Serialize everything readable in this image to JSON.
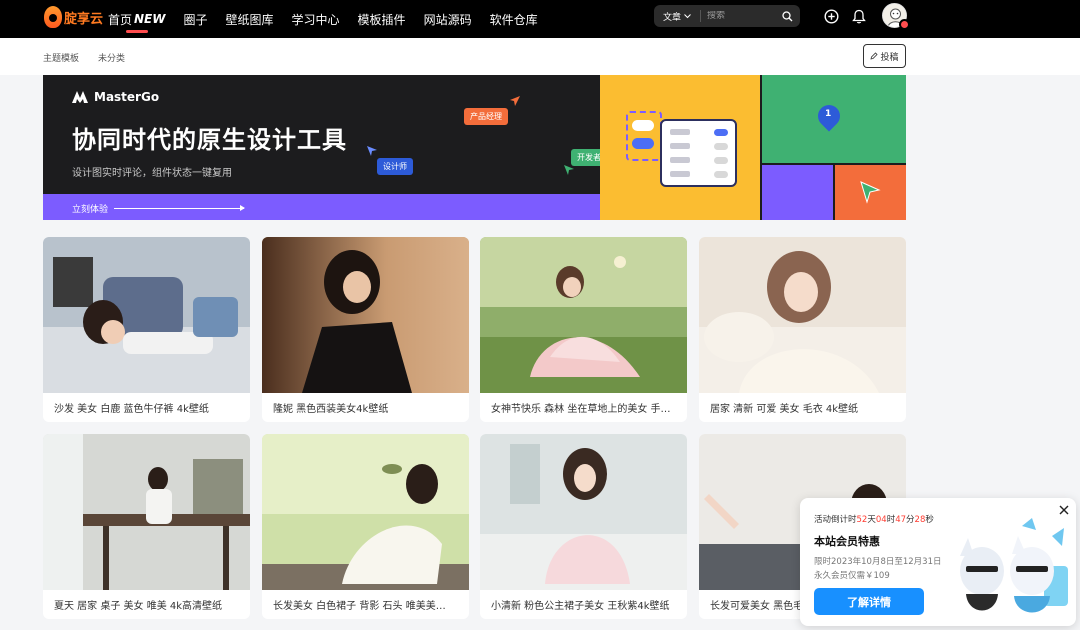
{
  "header": {
    "logo_text": "腚享云",
    "nav": [
      {
        "label": "首页",
        "suffix": "NEW"
      },
      {
        "label": "圈子"
      },
      {
        "label": "壁纸图库"
      },
      {
        "label": "学习中心"
      },
      {
        "label": "模板插件"
      },
      {
        "label": "网站源码"
      },
      {
        "label": "软件仓库"
      }
    ],
    "search": {
      "type_label": "文章",
      "placeholder": "搜索"
    },
    "icons": [
      "plus-circle-icon",
      "bell-icon",
      "avatar"
    ]
  },
  "subnav": {
    "items": [
      "主题模板",
      "未分类"
    ],
    "post_label": "投稿"
  },
  "banner": {
    "brand": "MasterGo",
    "title": "协同时代的原生设计工具",
    "subtitle": "设计图实时评论，组件状态一键复用",
    "cta": "立刻体验",
    "tags": [
      "产品经理",
      "开发者",
      "设计师"
    ],
    "pin_number": "1",
    "colors": {
      "dark": "#1c1c1e",
      "purple": "#7c5cff",
      "yellow": "#fbbd31",
      "green": "#3fb172",
      "orange": "#f36d3b"
    }
  },
  "cards": [
    {
      "title": "沙发 美女 白鹿 蓝色牛仔裤 4k壁纸"
    },
    {
      "title": "隆妮 黑色西装美女4k壁纸"
    },
    {
      "title": "女神节快乐 森林 坐在草地上的美女 手…"
    },
    {
      "title": "居家 清新 可爱 美女 毛衣 4k壁纸"
    },
    {
      "title": "夏天 居家 桌子 美女 唯美 4k高清壁纸"
    },
    {
      "title": "长发美女 白色裙子 背影 石头 唯美美…"
    },
    {
      "title": "小清新 粉色公主裙子美女 王秋紫4k壁纸"
    },
    {
      "title": "长发可爱美女 黑色毛"
    }
  ],
  "promo": {
    "countdown_prefix": "活动倒计时",
    "days": "52",
    "days_unit": "天",
    "hours": "04",
    "hours_unit": "时",
    "minutes": "47",
    "minutes_unit": "分",
    "seconds": "28",
    "seconds_unit": "秒",
    "title": "本站会员特惠",
    "period": "限时2023年10月8日至12月31日",
    "price": "永久会员仅需￥109",
    "button": "了解详情"
  }
}
